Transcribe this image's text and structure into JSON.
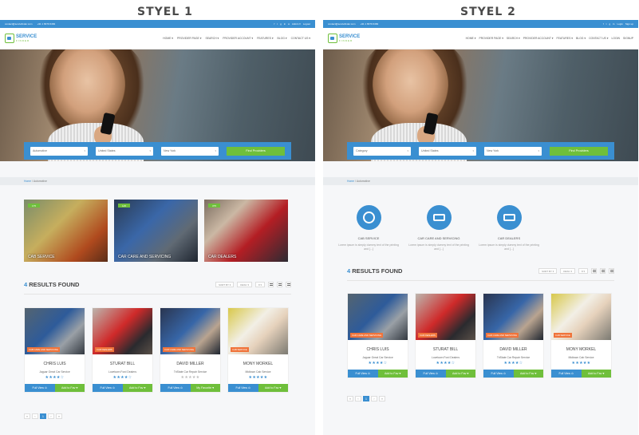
{
  "headings": {
    "left": "STYEL 1",
    "right": "STYEL 2"
  },
  "topbar": {
    "email": "contact@serviefinder.com",
    "phone": "+91 1 8379 6484",
    "left_user": "Admin ▾",
    "left_logout": "Logout",
    "right_login": "Login",
    "right_signup": "Sign up"
  },
  "logo": {
    "line1": "SERVICE",
    "line2": "FINDER"
  },
  "nav": {
    "left": [
      "HOME ▾",
      "PROVIDER PAGE ▾",
      "SEARCH ▾",
      "PROVIDER ACCOUNT ▾",
      "FEATURES ▾",
      "BLOG ▾",
      "CONTACT US ▾"
    ],
    "right": [
      "HOME ▾",
      "PROVIDER PAGE ▾",
      "SEARCH ▾",
      "PROVIDER ACCOUNT ▾",
      "FEATURES ▾",
      "BLOG ▾",
      "CONTACT US ▾",
      "LOGIN",
      "SIGNUP"
    ]
  },
  "search": {
    "left": {
      "category": "Automotive",
      "country": "United States",
      "city": "New York",
      "button": "Find Providers"
    },
    "right": {
      "category": "Category",
      "country": "United States",
      "city": "New York",
      "button": "Find Providers"
    }
  },
  "breadcrumb": {
    "home": "Home",
    "current": "Automotive"
  },
  "categories": [
    {
      "label": "CAB SERVICE",
      "count": "175"
    },
    {
      "label": "CAR CARE AND SERVICING",
      "count": "125"
    },
    {
      "label": "CAR DEALERS",
      "count": "375"
    }
  ],
  "services": [
    {
      "name": "CAB SERVICE",
      "desc": "Lorem ipsum is simply dummy text of the printing and [...]"
    },
    {
      "name": "CAR CARE AND SERVICING",
      "desc": "Lorem ipsum is simply dummy text of the printing and [...]"
    },
    {
      "name": "CAR DEALERS",
      "desc": "Lorem ipsum is simply dummy text of the printing and [...]"
    }
  ],
  "results": {
    "count": "4",
    "label": "RESULTS FOUND",
    "sort": "SORT BY ▾",
    "order": "DESC ▾",
    "per": "8 ▾"
  },
  "cards_left": [
    {
      "name": "CHRIS LUIS",
      "service": "Jaguar Great Car Service",
      "stars": "★★★★☆",
      "badge": "CAB CARE AND SERVICING",
      "view": "Full View ⊙",
      "fav": "Add to Fav ♥"
    },
    {
      "name": "STURAT BILL",
      "service": "Lovetown Ford Dealers",
      "stars": "★★★★☆",
      "badge": "CAR DEALERS",
      "view": "Full View ⊙",
      "fav": "Add to Fav ♥"
    },
    {
      "name": "DAVID MILLER",
      "service": "TriState Car Repair Service",
      "stars": "★★★★★",
      "badge": "CAR CARE AND SERVICING",
      "view": "Full View ⊙",
      "fav": "My Favorite ♥"
    },
    {
      "name": "MONY MORKEL",
      "service": "Midtown Cab Service",
      "stars": "★★★★★",
      "badge": "CAB SERVICE",
      "view": "Full View ⊙",
      "fav": "Add to Fav ♥"
    }
  ],
  "cards_right": [
    {
      "name": "CHRIS LUIS",
      "service": "Jaguar Great Car Service",
      "stars": "★★★★☆",
      "badge": "CAR CARE AND SERVICING",
      "view": "Full View ⊙",
      "fav": "Add to Fav ♥"
    },
    {
      "name": "STURAT BILL",
      "service": "Lovetown Ford Dealers",
      "stars": "★★★★☆",
      "badge": "CAR DEALERS",
      "view": "Full View ⊙",
      "fav": "Add to Fav ♥"
    },
    {
      "name": "DAVID MILLER",
      "service": "TriState Car Repair Service",
      "stars": "★★★★☆",
      "badge": "CAR CARE AND SERVICING",
      "view": "Full View ⊙",
      "fav": "Add to Fav ♥"
    },
    {
      "name": "MONY MORKEL",
      "service": "Midtown Cab Service",
      "stars": "★★★★★",
      "badge": "CAB SERVICE",
      "view": "Full View ⊙",
      "fav": "Add to Fav ♥"
    }
  ],
  "pagination": [
    "«",
    "‹",
    "1",
    "›",
    "»"
  ],
  "colors": {
    "primary": "#3a8fd1",
    "accent": "#6fbf3b",
    "badge": "#f0743b"
  }
}
